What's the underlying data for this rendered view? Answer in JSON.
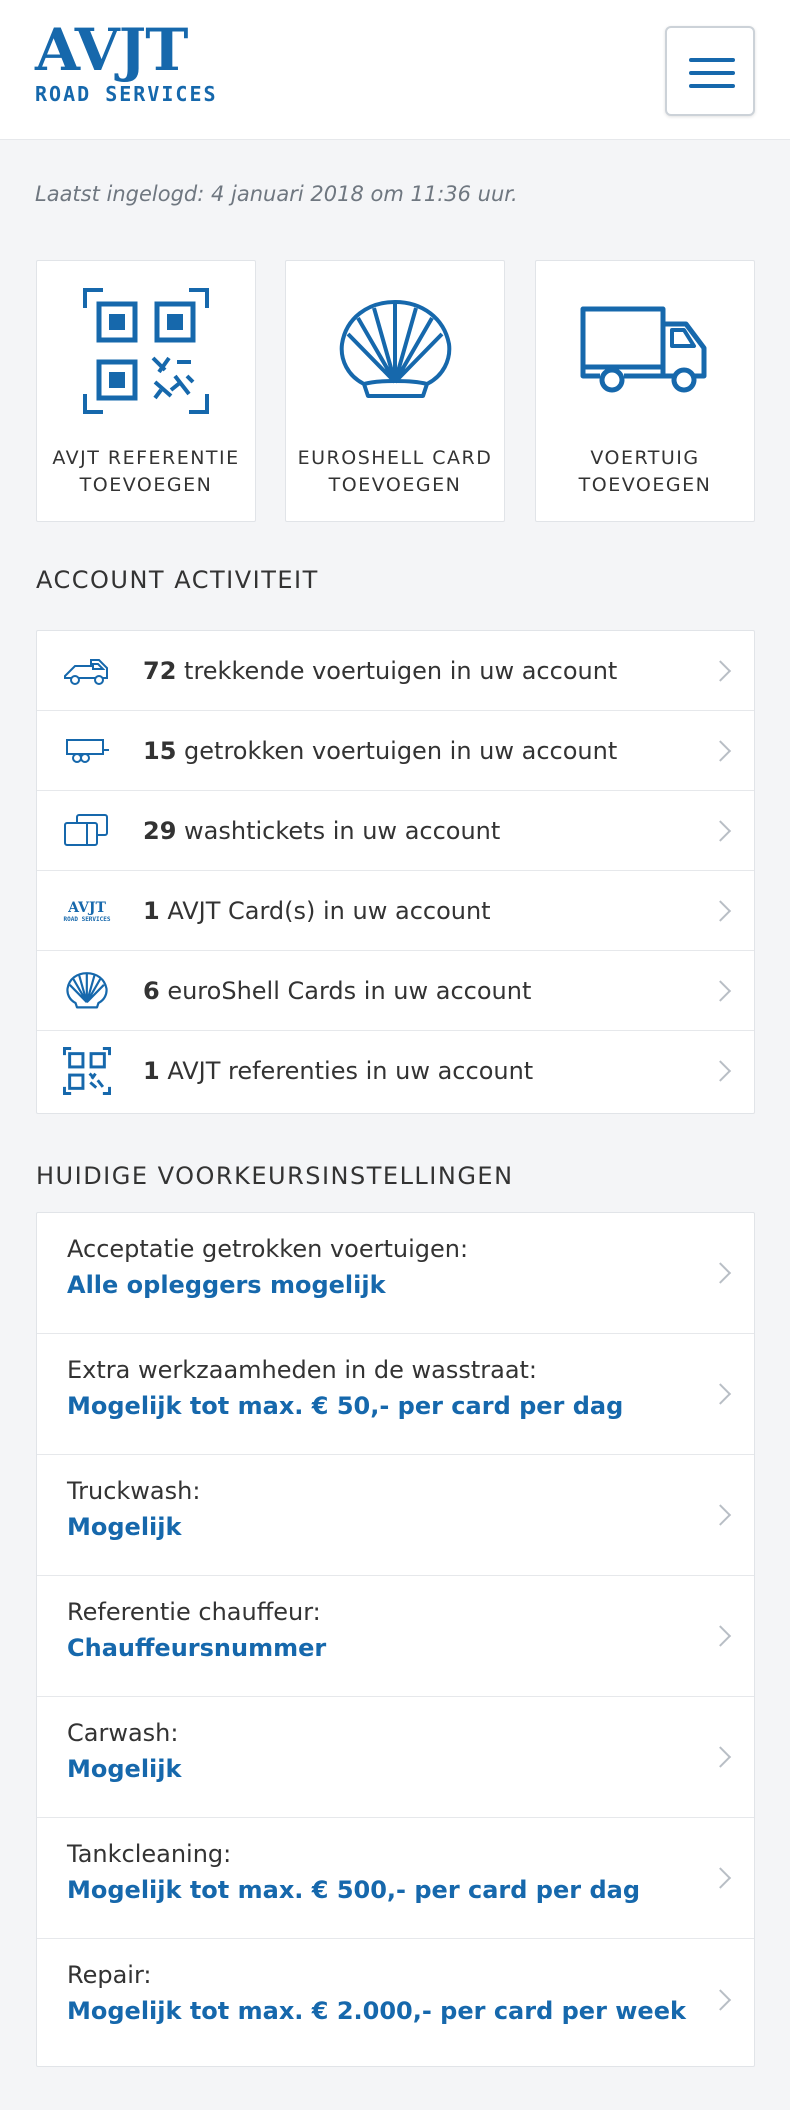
{
  "colors": {
    "accent": "#1668ac",
    "background": "#f4f5f7",
    "card": "#ffffff"
  },
  "header": {
    "logo_main": "AVJT",
    "logo_sub": "ROAD SERVICES",
    "menu_icon": "hamburger-menu-icon"
  },
  "last_login": "Laatst ingelogd: 4 januari 2018 om 11:36 uur.",
  "tiles": [
    {
      "icon": "qr-code-icon",
      "label": "AVJT REFERENTIE TOEVOEGEN"
    },
    {
      "icon": "shell-icon",
      "label": "EUROSHELL CARD TOEVOEGEN"
    },
    {
      "icon": "truck-icon",
      "label": "VOERTUIG TOEVOEGEN"
    }
  ],
  "activity": {
    "title": "ACCOUNT ACTIVITEIT",
    "rows": [
      {
        "icon": "truck-icon",
        "count": "72",
        "text": " trekkende voertuigen in uw account"
      },
      {
        "icon": "trailer-icon",
        "count": "15",
        "text": " getrokken voertuigen in uw account"
      },
      {
        "icon": "wash-tickets-icon",
        "count": "29",
        "text": " washtickets in uw account"
      },
      {
        "icon": "avjt-logo-icon",
        "count": "1",
        "text": " AVJT Card(s) in uw account"
      },
      {
        "icon": "shell-icon",
        "count": "6",
        "text": " euroShell Cards in uw account"
      },
      {
        "icon": "qr-code-icon",
        "count": "1",
        "text": " AVJT referenties in uw account"
      }
    ]
  },
  "preferences": {
    "title": "HUIDIGE VOORKEURSINSTELLINGEN",
    "rows": [
      {
        "label": "Acceptatie getrokken voertuigen:",
        "value": "Alle opleggers mogelijk"
      },
      {
        "label": "Extra werkzaamheden in de wasstraat:",
        "value": "Mogelijk tot max. € 50,- per card per dag"
      },
      {
        "label": "Truckwash:",
        "value": "Mogelijk"
      },
      {
        "label": "Referentie chauffeur:",
        "value": "Chauffeursnummer"
      },
      {
        "label": "Carwash:",
        "value": "Mogelijk"
      },
      {
        "label": "Tankcleaning:",
        "value": "Mogelijk tot max. € 500,- per card per dag"
      },
      {
        "label": "Repair:",
        "value": "Mogelijk tot max. € 2.000,- per card per week"
      }
    ]
  }
}
